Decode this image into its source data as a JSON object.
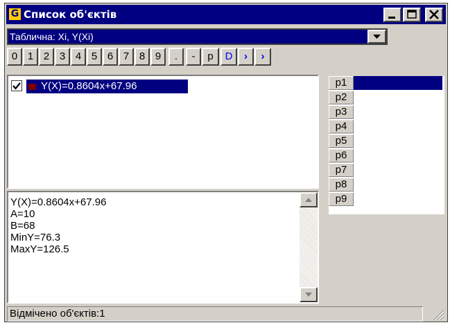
{
  "window": {
    "title": "Список об'єктів",
    "app_icon_letter": "G",
    "controls": [
      "minimize-icon",
      "maximize-icon",
      "close-icon"
    ]
  },
  "combo": {
    "selected": "Таблична: Xi, Y(Xi)",
    "arrow_icon": "chevron-down-icon"
  },
  "keypad": {
    "keys": [
      "0",
      "1",
      "2",
      "3",
      "4",
      "5",
      "6",
      "7",
      "8",
      "9",
      ".",
      "-",
      "p",
      "D",
      "›",
      "›"
    ]
  },
  "objects": {
    "items": [
      {
        "checked": true,
        "color": "#800000",
        "label": "Y(X)=0.8604x+67.96"
      }
    ]
  },
  "info": {
    "lines": [
      "Y(X)=0.8604x+67.96",
      "A=10",
      "B=68",
      "MinY=76.3",
      "MaxY=126.5"
    ]
  },
  "params": {
    "names": [
      "p1",
      "p2",
      "p3",
      "p4",
      "p5",
      "p6",
      "p7",
      "p8",
      "p9"
    ],
    "selected": "p1"
  },
  "status": {
    "text": "Відмічено об'єктів:1"
  },
  "colors": {
    "selection": "#000080",
    "face": "#d4d0c8",
    "link_key": "#0000ff"
  }
}
